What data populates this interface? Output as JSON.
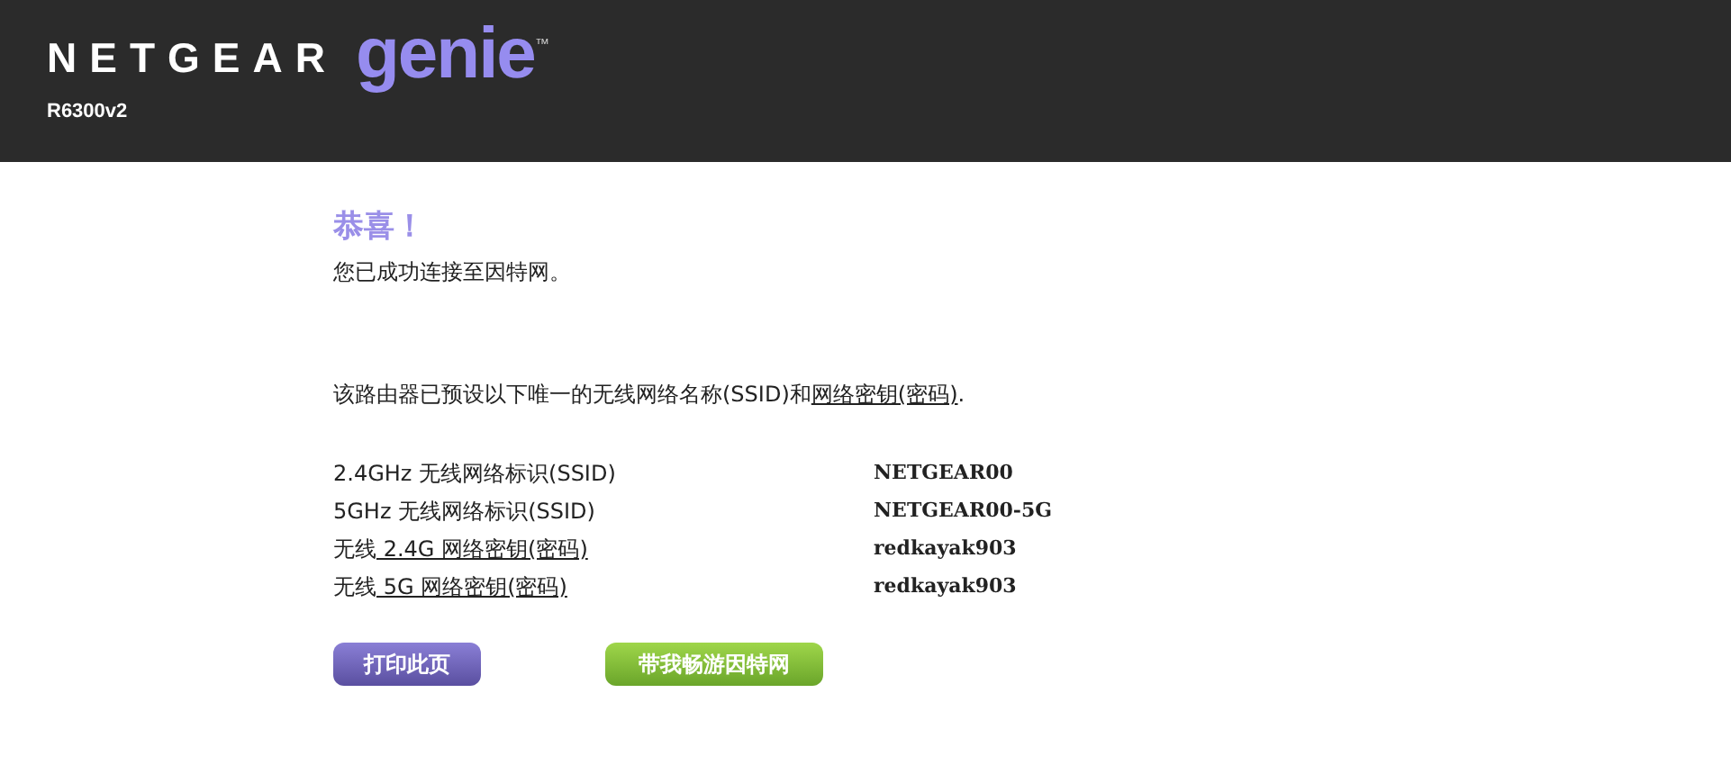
{
  "header": {
    "brand": "NETGEAR",
    "product": "genie",
    "trademark": "™",
    "model": "R6300v2"
  },
  "title": "恭喜！",
  "subtitle": "您已成功连接至因特网。",
  "intro": {
    "text": "该路由器已预设以下唯一的无线网络名称(SSID)和",
    "link": "网络密钥(密码)",
    "end": "."
  },
  "rows": [
    {
      "label": "2.4GHz 无线网络标识(SSID)",
      "value": "NETGEAR00"
    },
    {
      "label": "5GHz 无线网络标识(SSID)",
      "value": "NETGEAR00-5G"
    },
    {
      "label": "无线",
      "link": " 2.4G 网络密钥(密码)",
      "value": "redkayak903"
    },
    {
      "label": "无线",
      "link": " 5G 网络密钥(密码)",
      "value": "redkayak903"
    }
  ],
  "buttons": [
    {
      "label": "打印此页",
      "kind": "print"
    },
    {
      "label": "带我畅游因特网",
      "kind": "go"
    }
  ]
}
